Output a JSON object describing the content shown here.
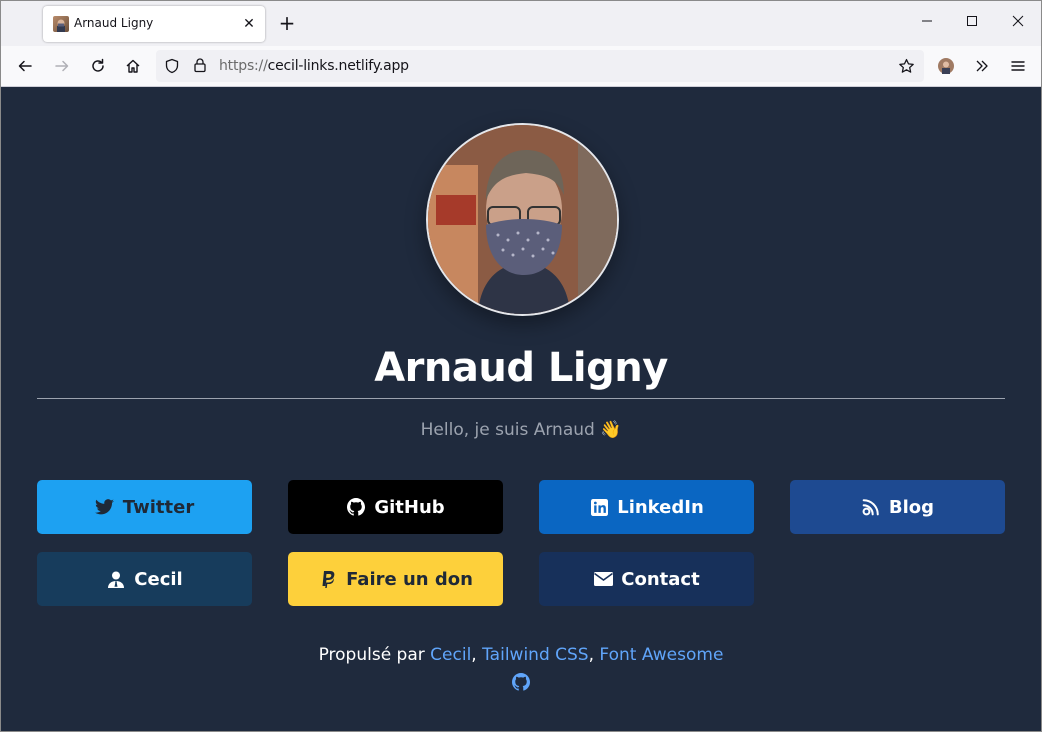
{
  "browser": {
    "tab_title": "Arnaud Ligny",
    "url_scheme": "https://",
    "url_host": "cecil-links.netlify.app"
  },
  "profile": {
    "name": "Arnaud Ligny",
    "tagline": "Hello, je suis Arnaud 👋"
  },
  "links": [
    {
      "label": "Twitter",
      "icon": "twitter-icon",
      "bg": "#1da1f2",
      "fg": "#1f2937"
    },
    {
      "label": "GitHub",
      "icon": "github-icon",
      "bg": "#000000",
      "fg": "#ffffff"
    },
    {
      "label": "LinkedIn",
      "icon": "linkedin-icon",
      "bg": "#0a66c2",
      "fg": "#ffffff"
    },
    {
      "label": "Blog",
      "icon": "blog-icon",
      "bg": "#1e4a91",
      "fg": "#ffffff"
    },
    {
      "label": "Cecil",
      "icon": "user-icon",
      "bg": "#173c5c",
      "fg": "#ffffff"
    },
    {
      "label": "Faire un don",
      "icon": "paypal-icon",
      "bg": "#fdd03b",
      "fg": "#1f2937"
    },
    {
      "label": "Contact",
      "icon": "envelope-icon",
      "bg": "#17305a",
      "fg": "#ffffff"
    }
  ],
  "footer": {
    "prefix": "Propulsé par ",
    "links": [
      "Cecil",
      "Tailwind CSS",
      "Font Awesome"
    ],
    "sep": ", "
  },
  "colors": {
    "page_bg": "#1f2a3d",
    "link": "#60a5fa"
  }
}
